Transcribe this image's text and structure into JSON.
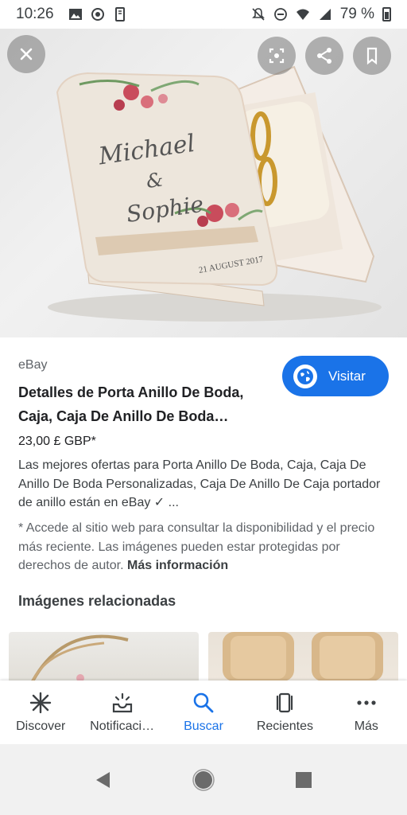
{
  "status_bar": {
    "time": "10:26",
    "battery": "79 %"
  },
  "hero": {
    "image_alt": "Caja portaanillos de madera",
    "name_text": "Michael & Sophie",
    "date_text": "21 AUGUST 2017"
  },
  "result": {
    "source": "eBay",
    "title": "Detalles de Porta Anillo De Boda, Caja, Caja De Anillo De Boda…",
    "visit_label": "Visitar",
    "price": "23,00 £ GBP*",
    "description": "Las mejores ofertas para Porta Anillo De Boda, Caja, Caja De Anillo De Boda Personalizadas, Caja De Anillo De Caja portador de anillo están en eBay ✓ ...",
    "disclaimer": "* Accede al sitio web para consultar la disponibilidad y el precio más reciente. Las imágenes pueden estar protegidas por derechos de autor.",
    "more_info": "Más información"
  },
  "related": {
    "heading": "Imágenes relacionadas"
  },
  "bottom_nav": {
    "items": [
      {
        "label": "Discover",
        "icon": "asterisk-icon"
      },
      {
        "label": "Notificaci…",
        "icon": "bell-tray-icon"
      },
      {
        "label": "Buscar",
        "icon": "search-icon"
      },
      {
        "label": "Recientes",
        "icon": "recent-cards-icon"
      },
      {
        "label": "Más",
        "icon": "more-dots-icon"
      }
    ],
    "active_index": 2
  },
  "colors": {
    "accent": "#1a73e8",
    "text": "#202124",
    "secondary_text": "#5f6368"
  }
}
